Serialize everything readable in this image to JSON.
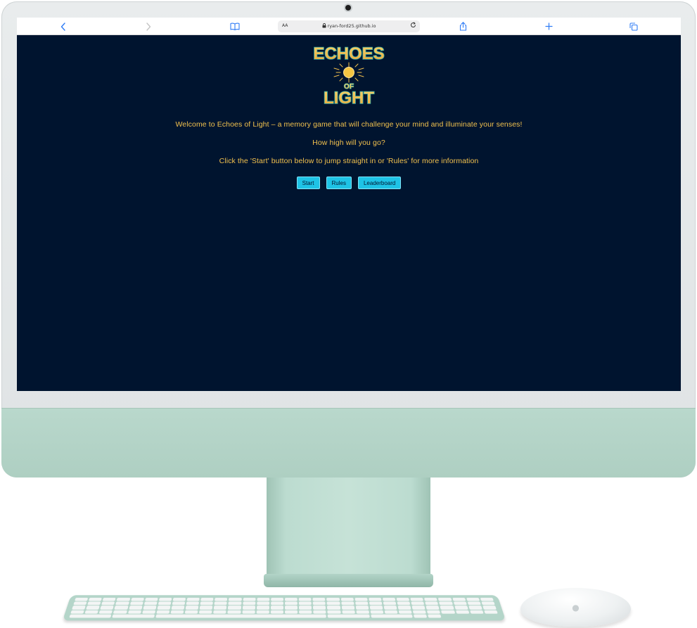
{
  "browser": {
    "back_icon": "chevron-left-icon",
    "forward_icon": "chevron-right-icon",
    "bookmarks_icon": "book-icon",
    "text_size_label": "AA",
    "lock_icon": "lock-icon",
    "url": "ryan-ford25.github.io",
    "reload_icon": "reload-icon",
    "share_icon": "share-icon",
    "new_tab_icon": "plus-icon",
    "tabs_icon": "tabs-icon"
  },
  "game": {
    "logo_line1": "ECHOES",
    "logo_line2": "OF",
    "logo_line3": "LIGHT",
    "intro_1": "Welcome to Echoes of Light – a memory game that will challenge your mind and illuminate your senses!",
    "intro_2": "How high will you go?",
    "intro_3": "Click the 'Start' button below to jump straight in or 'Rules' for more information",
    "buttons": {
      "start": "Start",
      "rules": "Rules",
      "leaderboard": "Leaderboard"
    }
  },
  "colors": {
    "page_background": "#00142f",
    "text_gold": "#f2c14e",
    "button_cyan": "#1ec3e6",
    "logo_teal": "#2ca6a4",
    "browser_accent": "#2f7cf6"
  }
}
